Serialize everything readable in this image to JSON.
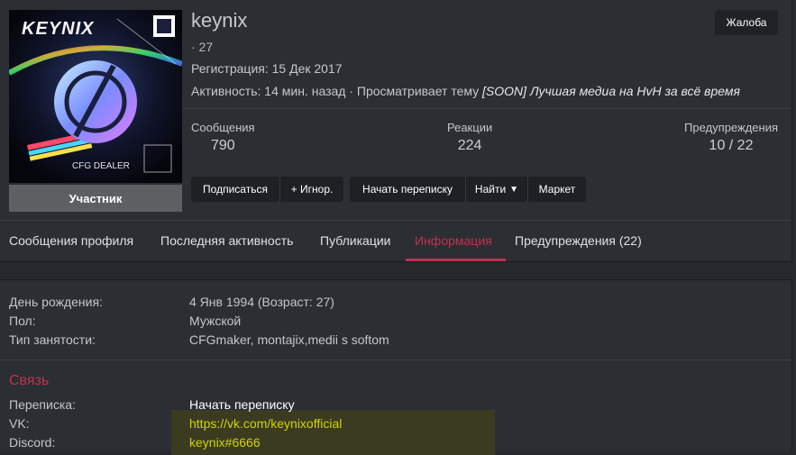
{
  "profile": {
    "username": "keynix",
    "dot_line": "· 27",
    "registration": "Регистрация: 15 Дек 2017",
    "activity_prefix": "Активность: 14 мин. назад · Просматривает тему",
    "activity_thread": "[SOON] Лучшая медиа на HvH за всё время",
    "role": "Участник",
    "avatar_text": "KEYNIX",
    "avatar_caption": "CFG DEALER",
    "report_label": "Жалоба"
  },
  "stats": [
    {
      "label": "Сообщения",
      "value": "790"
    },
    {
      "label": "Реакции",
      "value": "224"
    },
    {
      "label": "Предупреждения",
      "value": "10 / 22"
    }
  ],
  "actions": {
    "subscribe": "Подписаться",
    "ignore": "+ Игнор.",
    "start_conversation": "Начать переписку",
    "find": "Найти",
    "market": "Маркет"
  },
  "tabs": [
    {
      "label": "Сообщения профиля"
    },
    {
      "label": "Последняя активность"
    },
    {
      "label": "Публикации"
    },
    {
      "label": "Информация"
    },
    {
      "label": "Предупреждения (22)"
    }
  ],
  "info": {
    "rows": [
      {
        "label": "День рождения:",
        "value": "4 Янв 1994 (Возраст: 27)"
      },
      {
        "label": "Пол:",
        "value": "Мужской"
      },
      {
        "label": "Тип занятости:",
        "value": "CFGmaker, montajix,medii s softom"
      }
    ],
    "contact_title": "Связь",
    "contacts": [
      {
        "label": "Переписка:",
        "value": "Начать переписку"
      },
      {
        "label": "VK:",
        "value": "https://vk.com/keynixofficial"
      },
      {
        "label": "Discord:",
        "value": "keynix#6666"
      }
    ]
  },
  "colors": {
    "accent": "#c0304e",
    "background": "#27292d",
    "panel": "#2b2e33",
    "button": "#1e2023",
    "link_highlight": "#d4d400"
  }
}
